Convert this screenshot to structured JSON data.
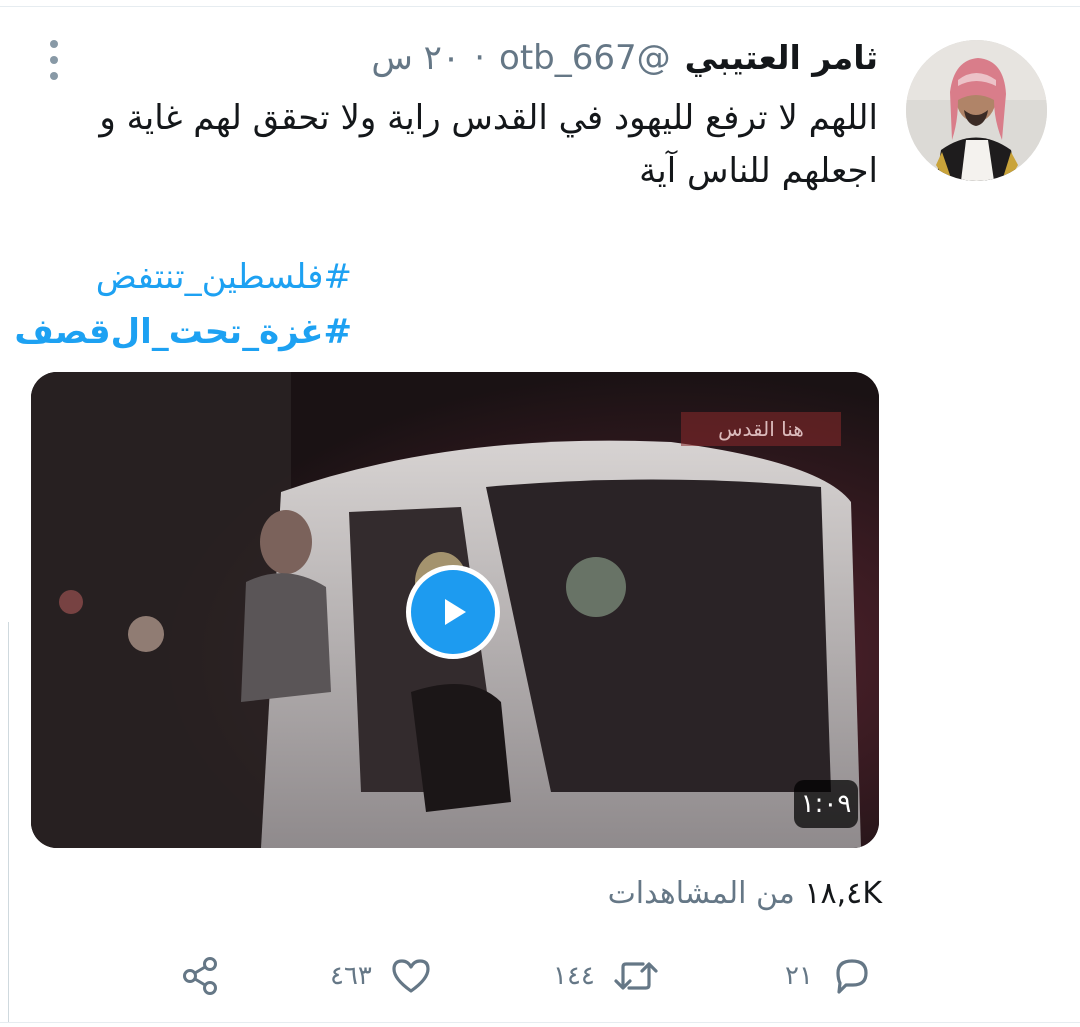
{
  "tweet": {
    "author_name": "ثامر العتيبي",
    "handle": "@otb_667",
    "separator": "·",
    "time": "٢٠ س",
    "text_lines": [
      "اللهم لا ترفع لليهود في القدس راية ولا تحقق لهم غاية و",
      "اجعلهم للناس آية"
    ],
    "hashtags": [
      "#فلسطين_تنتفض",
      "#غزة_تحت_ال‌قصف"
    ]
  },
  "video": {
    "duration": "١:٠٩",
    "watermark": "هنا القدس"
  },
  "views": {
    "count": "١٨,٤K",
    "label": "من المشاهدات"
  },
  "actions": {
    "replies": "٢١",
    "retweets": "١٤٤",
    "likes": "٤٦٣"
  },
  "colors": {
    "link": "#1da1f2",
    "text": "#14171a",
    "muted": "#657786",
    "play": "#1d9bf0"
  }
}
